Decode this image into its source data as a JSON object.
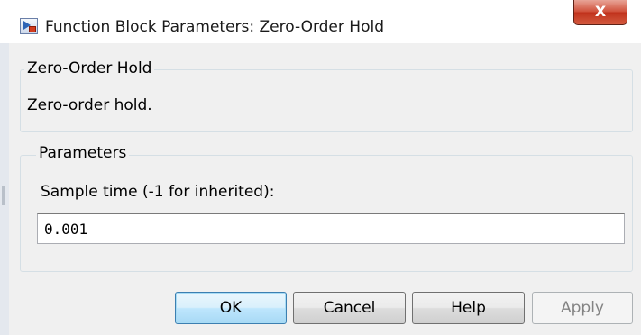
{
  "window": {
    "title": "Function Block Parameters: Zero-Order Hold",
    "close_label": "X"
  },
  "block": {
    "name": "Zero-Order Hold",
    "description": "Zero-order hold."
  },
  "parameters": {
    "legend": "Parameters",
    "sample_time_label": "Sample time (-1 for inherited):",
    "sample_time_value": "0.001"
  },
  "buttons": {
    "ok": "OK",
    "cancel": "Cancel",
    "help": "Help",
    "apply": "Apply"
  },
  "icons": {
    "app": "simulink-block-icon",
    "close": "close-icon"
  },
  "colors": {
    "dialog_bg": "#f0f0f0",
    "close_button": "#c7442d",
    "default_button": "#bee6fd"
  }
}
